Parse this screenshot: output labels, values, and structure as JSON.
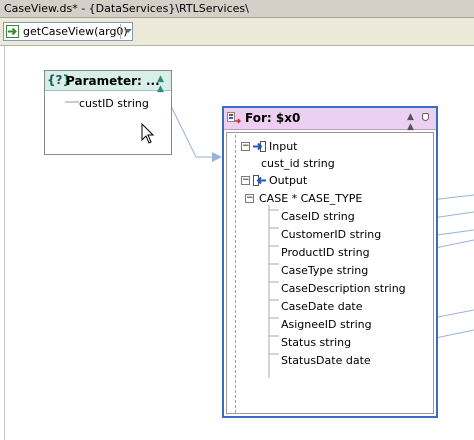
{
  "window": {
    "title": "CaseView.ds* - {DataServices}\\RTLServices\\"
  },
  "toolbar": {
    "operation": "getCaseView(arg0)"
  },
  "parameter": {
    "title": "Parameter: ...",
    "tag": "{?}",
    "items": [
      {
        "label": "custID  string"
      }
    ]
  },
  "for_node": {
    "title": "For: $x0",
    "input_label": "Input",
    "input_items": [
      {
        "label": "cust_id  string"
      }
    ],
    "output_label": "Output",
    "case_label": "CASE * CASE_TYPE",
    "fields": [
      {
        "label": "CaseID  string"
      },
      {
        "label": "CustomerID  string"
      },
      {
        "label": "ProductID  string"
      },
      {
        "label": "CaseType  string"
      },
      {
        "label": "CaseDescription  string"
      },
      {
        "label": "CaseDate  date"
      },
      {
        "label": "AsigneeID  string"
      },
      {
        "label": "Status  string"
      },
      {
        "label": "StatusDate  date"
      }
    ]
  },
  "colors": {
    "param_header": "#d7efe8",
    "for_header": "#eccff2",
    "for_border": "#3d6bc0",
    "link_line": "#9ab2d6"
  }
}
